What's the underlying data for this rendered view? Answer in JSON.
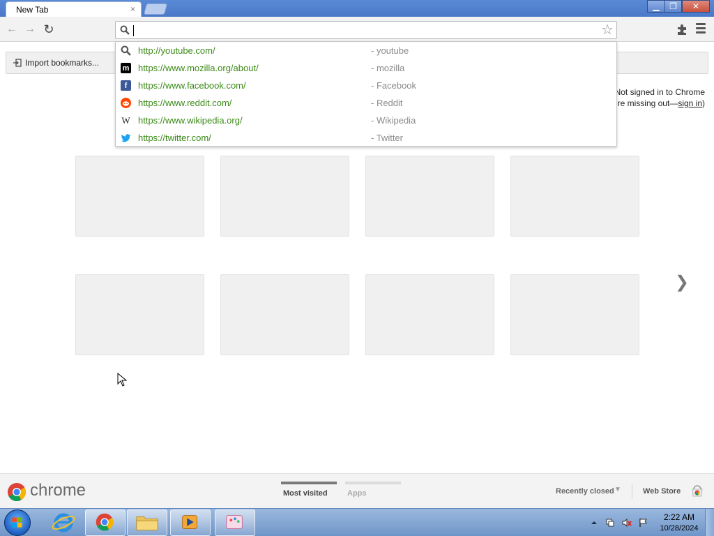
{
  "window": {
    "tab_title": "New Tab",
    "tab_close": "×",
    "min_label": "▁",
    "max_label": "❐",
    "close_label": "✕"
  },
  "toolbar": {
    "back_glyph": "←",
    "forward_glyph": "→",
    "reload_glyph": "↻",
    "omnibox_value": "",
    "star_glyph": "☆"
  },
  "bookmarks": {
    "import_label": "Import bookmarks..."
  },
  "suggestions": [
    {
      "url": "http://youtube.com/",
      "title": "- youtube",
      "icon": "search-icon",
      "icon_color": "#ffffff"
    },
    {
      "url": "https://www.mozilla.org/about/",
      "title": "- mozilla",
      "icon": "mozilla-icon",
      "icon_color": "#000000"
    },
    {
      "url": "https://www.facebook.com/",
      "title": "- Facebook",
      "icon": "facebook-icon",
      "icon_color": "#3b5998"
    },
    {
      "url": "https://www.reddit.com/",
      "title": "- Reddit",
      "icon": "reddit-icon",
      "icon_color": "#ff4500"
    },
    {
      "url": "https://www.wikipedia.org/",
      "title": "- Wikipedia",
      "icon": "wikipedia-icon",
      "icon_color": "#ffffff"
    },
    {
      "url": "https://twitter.com/",
      "title": "- Twitter",
      "icon": "twitter-icon",
      "icon_color": "#1da1f2"
    }
  ],
  "signin": {
    "line1": "Not signed in to Chrome",
    "line2_prefix": "re missing out—",
    "link": "sign in",
    "line2_suffix": ")"
  },
  "next_arrow": "❯",
  "footer": {
    "brand": "chrome",
    "tab_most_visited": "Most visited",
    "tab_apps": "Apps",
    "recently_closed": "Recently closed",
    "recent_caret": "▼",
    "web_store": "Web Store"
  },
  "taskbar": {
    "time": "2:22 AM",
    "date": "10/28/2024"
  },
  "colors": {
    "url_green": "#3a8a16",
    "accent_blue": "#4a78c8",
    "footer_active_tab": "#7a7a7a",
    "footer_inactive_tab": "#dcdcdc"
  }
}
